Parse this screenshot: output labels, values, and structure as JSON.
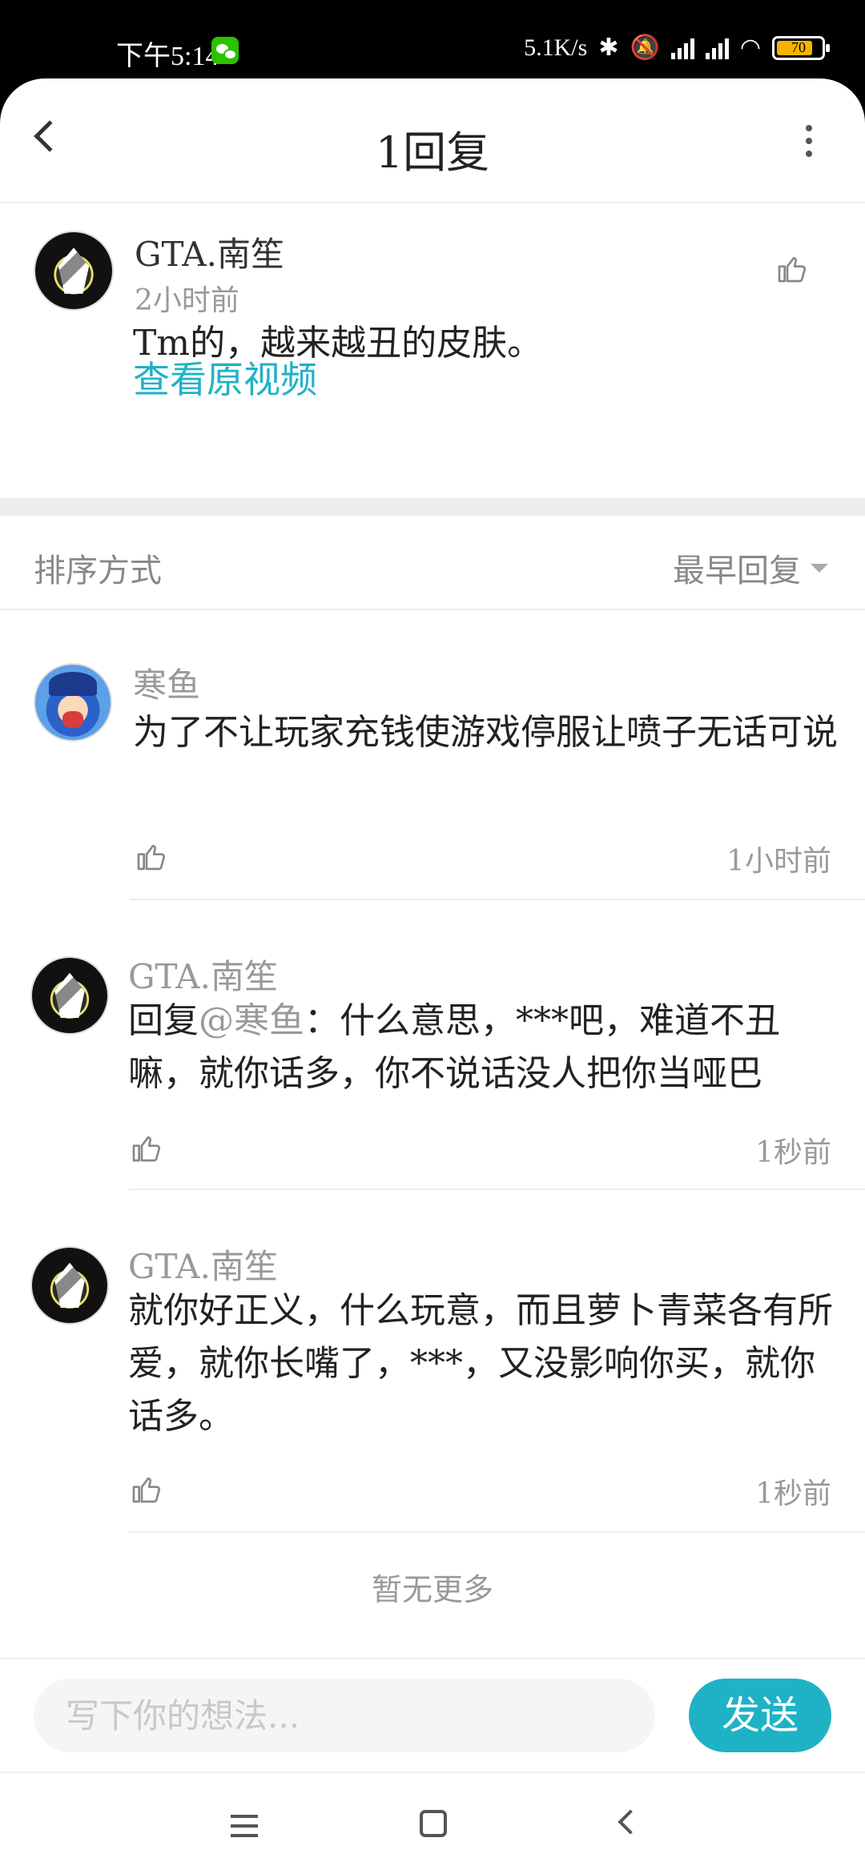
{
  "status_bar": {
    "time": "下午5:14",
    "network_speed": "5.1K/s",
    "battery": "70"
  },
  "header": {
    "title": "1回复"
  },
  "main_comment": {
    "user": "GTA.南笙",
    "time": "2小时前",
    "text": "Tm的，越来越丑的皮肤。",
    "view_original": "查看原视频"
  },
  "sort": {
    "label": "排序方式",
    "value": "最早回复"
  },
  "replies": [
    {
      "user": "寒鱼",
      "avatar": "fish-avatar",
      "reply_to": "",
      "text": "为了不让玩家充钱使游戏停服让喷子无话可说",
      "time": "1小时前"
    },
    {
      "user": "GTA.南笙",
      "avatar": "gta-avatar",
      "reply_prefix": "回复",
      "reply_to": "@寒鱼",
      "text": "：什么意思，***吧，难道不丑嘛，就你话多，你不说话没人把你当哑巴",
      "time": "1秒前"
    },
    {
      "user": "GTA.南笙",
      "avatar": "gta-avatar",
      "reply_to": "",
      "text": "就你好正义，什么玩意，而且萝卜青菜各有所爱，就你长嘴了，***，又没影响你买，就你话多。",
      "time": "1秒前"
    }
  ],
  "no_more": "暂无更多",
  "input": {
    "placeholder": "写下你的想法...",
    "send_label": "发送"
  },
  "colors": {
    "accent": "#1fb2c5",
    "muted_text": "#999999"
  }
}
